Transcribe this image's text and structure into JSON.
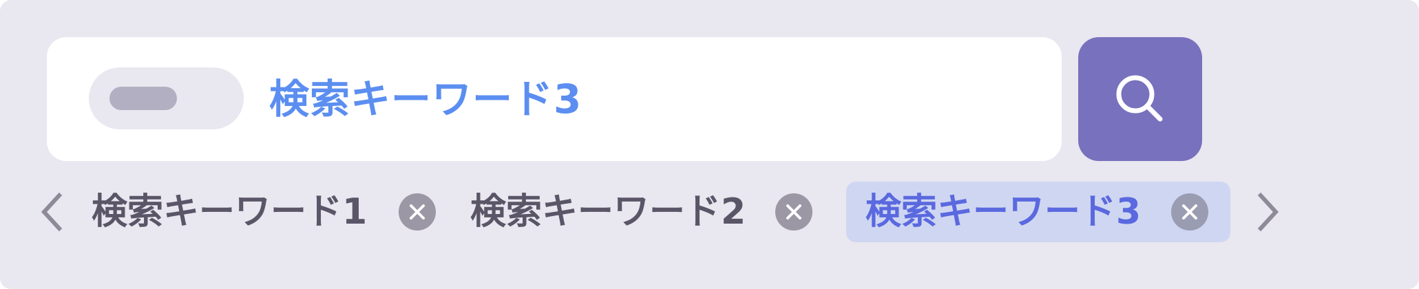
{
  "search": {
    "value": "検索キーワード3"
  },
  "tags": {
    "items": [
      {
        "label": "検索キーワード1"
      },
      {
        "label": "検索キーワード2"
      },
      {
        "label": "検索キーワード3",
        "selected": true
      }
    ]
  },
  "colors": {
    "panel_bg": "#e9e7ef",
    "search_button": "#7871bd",
    "search_text": "#5b8ef0",
    "active_tag_bg": "#cfd6f1",
    "active_tag_text": "#5a69df",
    "tag_text": "#5a5668"
  },
  "icons": {
    "search_button": "search-icon",
    "filter_toggle": "toggle-pill",
    "prev": "chevron-left-icon",
    "next": "chevron-right-icon",
    "tag_remove": "close-icon"
  }
}
